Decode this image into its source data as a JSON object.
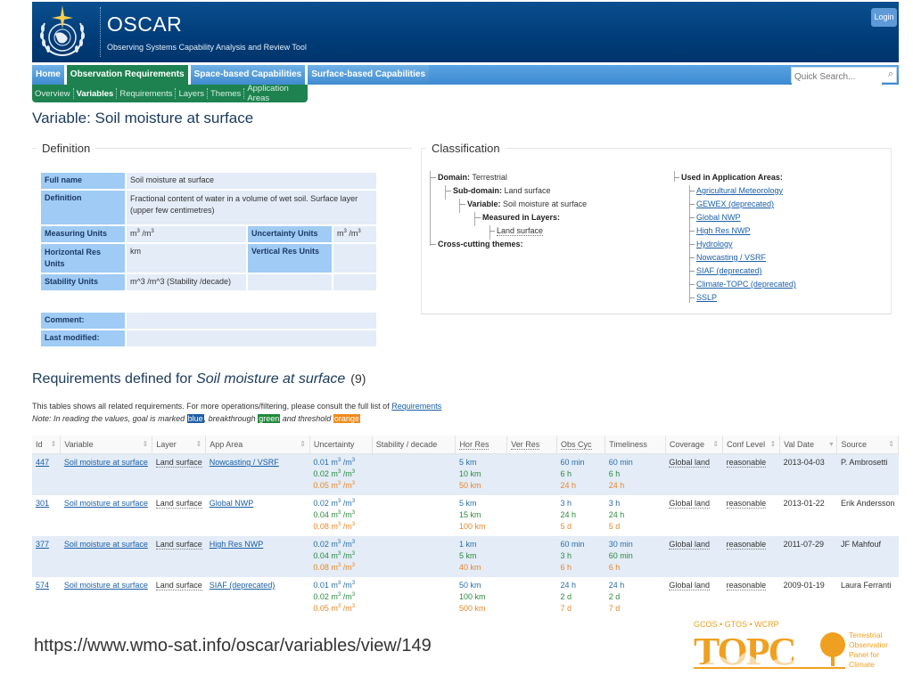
{
  "header": {
    "app_title": "OSCAR",
    "app_subtitle": "Observing Systems Capability Analysis and Review Tool",
    "login_label": "Login"
  },
  "nav": {
    "tabs": [
      {
        "label": "Home",
        "active": false
      },
      {
        "label": "Observation Requirements",
        "active": true
      },
      {
        "label": "Space-based Capabilities",
        "active": false
      },
      {
        "label": "Surface-based Capabilities",
        "active": false
      }
    ],
    "search_placeholder": "Quick Search...",
    "subnav": [
      {
        "label": "Overview",
        "active": false
      },
      {
        "label": "Variables",
        "active": true
      },
      {
        "label": "Requirements",
        "active": false
      },
      {
        "label": "Layers",
        "active": false
      },
      {
        "label": "Themes",
        "active": false
      },
      {
        "label": "Application Areas",
        "active": false
      }
    ]
  },
  "page": {
    "title": "Variable: Soil moisture at surface"
  },
  "definition": {
    "legend": "Definition",
    "full_name_label": "Full name",
    "full_name": "Soil moisture at surface",
    "definition_label": "Definition",
    "definition": "Fractional content of water in a volume of wet soil. Surface layer (upper few centimetres)",
    "measuring_units_label": "Measuring Units",
    "measuring_units": "m3 /m3",
    "uncertainty_units_label": "Uncertainty Units",
    "uncertainty_units": "m3 /m3",
    "hres_units_label": "Horizontal Res Units",
    "hres_units": "km",
    "vres_units_label": "Vertical Res Units",
    "vres_units": "",
    "stability_units_label": "Stability Units",
    "stability_units": "m^3 /m^3 (Stability /decade)",
    "comment_label": "Comment:",
    "comment": "",
    "last_modified_label": "Last modified:",
    "last_modified": ""
  },
  "classification": {
    "legend": "Classification",
    "domain_label": "Domain:",
    "domain": "Terrestrial",
    "subdomain_label": "Sub-domain:",
    "subdomain": "Land surface",
    "variable_label": "Variable:",
    "variable": "Soil moisture at surface",
    "layers_label": "Measured in Layers:",
    "layers": [
      "Land surface"
    ],
    "themes_label": "Cross-cutting themes:",
    "app_areas_label": "Used in Application Areas:",
    "app_areas": [
      "Agricultural Meteorology",
      "GEWEX (deprecated)",
      "Global NWP",
      "High Res NWP",
      "Hydrology",
      "Nowcasting / VSRF",
      "SIAF (deprecated)",
      "Climate-TOPC (deprecated)",
      "SSLP"
    ]
  },
  "requirements": {
    "title_prefix": "Requirements defined for",
    "title_variable": "Soil moisture at surface",
    "count": "(9)",
    "info_text": "This tables shows all related requirements. For more operations/filtering, please consult the full list of",
    "info_link": "Requirements",
    "note_prefix": "Note: In reading the values, goal is marked",
    "note_goal": "blue",
    "note_mid": ", breakthrough",
    "note_breakthrough": "green",
    "note_and": "and threshold",
    "note_threshold": "orange",
    "colors": {
      "goal": "#2a6fa8",
      "breakthrough": "#2b8a3e",
      "threshold": "#e8872a",
      "goal_tag": "#1f5ea8",
      "breakthrough_tag": "#1f8a3a",
      "threshold_tag": "#f08a1c"
    },
    "columns": [
      "Id",
      "Variable",
      "Layer",
      "App Area",
      "Uncertainty",
      "Stability / decade",
      "Hor Res",
      "Ver Res",
      "Obs Cyc",
      "Timeliness",
      "Coverage",
      "Conf Level",
      "Val Date",
      "Source"
    ],
    "rows": [
      {
        "id": "447",
        "variable": "Soil moisture at surface",
        "layer": "Land surface",
        "app_area": "Nowcasting / VSRF",
        "uncertainty": [
          "0.01",
          "0.02",
          "0.05"
        ],
        "stability": "",
        "hor_res": [
          "5 km",
          "10 km",
          "50 km"
        ],
        "ver_res": "",
        "obs_cyc": [
          "60 min",
          "6 h",
          "24 h"
        ],
        "timeliness": [
          "60 min",
          "6 h",
          "24 h"
        ],
        "coverage": "Global land",
        "conf_level": "reasonable",
        "val_date": "2013-04-03",
        "source": "P. Ambrosetti"
      },
      {
        "id": "301",
        "variable": "Soil moisture at surface",
        "layer": "Land surface",
        "app_area": "Global NWP",
        "uncertainty": [
          "0.02",
          "0.04",
          "0.08"
        ],
        "stability": "",
        "hor_res": [
          "5 km",
          "15 km",
          "100 km"
        ],
        "ver_res": "",
        "obs_cyc": [
          "3 h",
          "24 h",
          "5 d"
        ],
        "timeliness": [
          "3 h",
          "24 h",
          "5 d"
        ],
        "coverage": "Global land",
        "conf_level": "reasonable",
        "val_date": "2013-01-22",
        "source": "Erik Andersson"
      },
      {
        "id": "377",
        "variable": "Soil moisture at surface",
        "layer": "Land surface",
        "app_area": "High Res NWP",
        "uncertainty": [
          "0.02",
          "0.04",
          "0.08"
        ],
        "stability": "",
        "hor_res": [
          "1 km",
          "5 km",
          "40 km"
        ],
        "ver_res": "",
        "obs_cyc": [
          "60 min",
          "3 h",
          "6 h"
        ],
        "timeliness": [
          "30 min",
          "60 min",
          "6 h"
        ],
        "coverage": "Global land",
        "conf_level": "reasonable",
        "val_date": "2011-07-29",
        "source": "JF Mahfouf"
      },
      {
        "id": "574",
        "variable": "Soil moisture at surface",
        "layer": "Land surface",
        "app_area": "SIAF (deprecated)",
        "uncertainty": [
          "0.01",
          "0.02",
          "0.05"
        ],
        "stability": "",
        "hor_res": [
          "50 km",
          "100 km",
          "500 km"
        ],
        "ver_res": "",
        "obs_cyc": [
          "24 h",
          "2 d",
          "7 d"
        ],
        "timeliness": [
          "24 h",
          "2 d",
          "7 d"
        ],
        "coverage": "Global land",
        "conf_level": "reasonable",
        "val_date": "2009-01-19",
        "source": "Laura Ferranti"
      }
    ],
    "unit_suffix": "m3 /m3"
  },
  "footer": {
    "url": "https://www.wmo-sat.info/oscar/variables/view/149",
    "topc_top": "GCOS • GTOS • WCRP",
    "topc_name": "TOPC",
    "topc_caption": [
      "Terrestrial",
      "Observation",
      "Panel for",
      "Climate"
    ],
    "brand_color": "#f0a020"
  }
}
